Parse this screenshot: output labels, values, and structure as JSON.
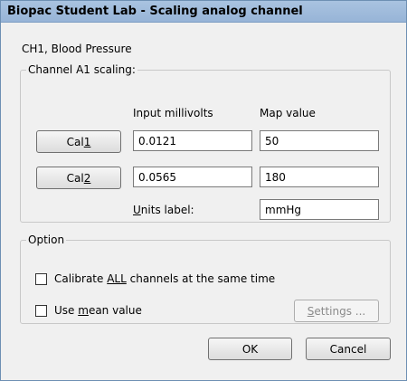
{
  "window": {
    "title": "Biopac Student Lab - Scaling analog channel"
  },
  "channel": {
    "name": "CH1, Blood Pressure"
  },
  "scaling": {
    "legend": "Channel A1 scaling:",
    "col_input": "Input millivolts",
    "col_map": "Map value",
    "cal1": {
      "pre": "Cal ",
      "accel": "1",
      "input": "0.0121",
      "map": "50"
    },
    "cal2": {
      "pre": "Cal ",
      "accel": "2",
      "input": "0.0565",
      "map": "180"
    },
    "units": {
      "accel": "U",
      "rest": "nits label:",
      "value": "mmHg"
    }
  },
  "option": {
    "legend": "Option",
    "calibrate_all": {
      "pre": "Calibrate ",
      "accel": "ALL",
      "post": " channels at the same time",
      "checked": false
    },
    "use_mean": {
      "pre": "Use ",
      "accel": "m",
      "post": "ean value",
      "checked": false
    },
    "settings": {
      "accel": "S",
      "rest": "ettings ...",
      "enabled": false
    }
  },
  "buttons": {
    "ok": "OK",
    "cancel": "Cancel"
  }
}
